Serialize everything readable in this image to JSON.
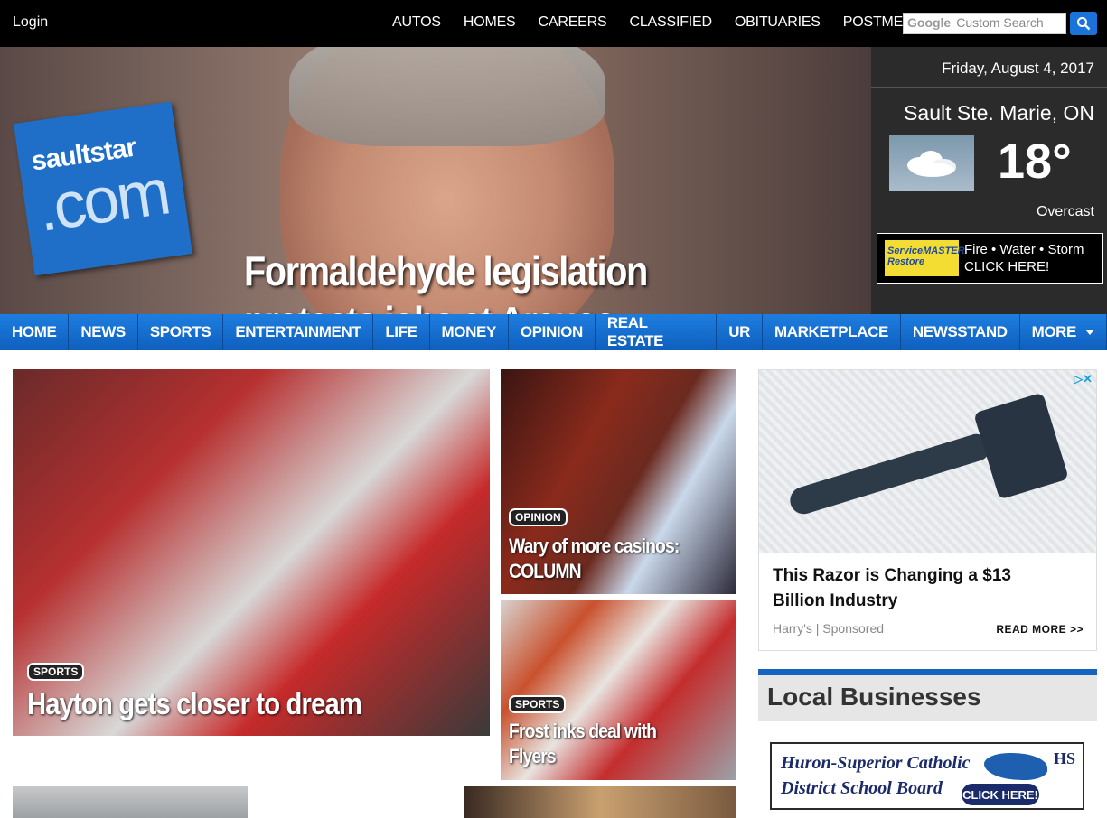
{
  "topbar": {
    "login": "Login",
    "nav": [
      "AUTOS",
      "HOMES",
      "CAREERS",
      "CLASSIFIED",
      "OBITUARIES",
      "POSTMEDIA"
    ],
    "search_brand": "Google",
    "search_placeholder": "Custom Search"
  },
  "logo": {
    "line1": "saultstar",
    "line2": ".com"
  },
  "hero": {
    "headline": "Formaldehyde legislation protects jobs at Arauco"
  },
  "weather": {
    "date": "Friday, August 4, 2017",
    "city": "Sault Ste. Marie, ON",
    "temp": "18°",
    "condition": "Overcast",
    "ad_brand": "ServiceMASTER Restore",
    "ad_line1": "Fire • Water • Storm",
    "ad_line2": "CLICK HERE!"
  },
  "mainnav": {
    "items": [
      "HOME",
      "NEWS",
      "SPORTS",
      "ENTERTAINMENT",
      "LIFE",
      "MONEY",
      "OPINION",
      "REAL ESTATE",
      "UR",
      "MARKETPLACE",
      "NEWSSTAND",
      "MORE"
    ]
  },
  "stories": [
    {
      "tag": "SPORTS",
      "title": "Hayton gets closer to dream"
    },
    {
      "tag": "OPINION",
      "title": "Wary of more casinos: COLUMN"
    },
    {
      "tag": "SPORTS",
      "title": "Frost inks deal with Flyers"
    }
  ],
  "ad": {
    "title": "This Razor is Changing a $13 Billion Industry",
    "sponsor": "Harry's | Sponsored",
    "readmore": "READ MORE >>"
  },
  "local": {
    "title": "Local Businesses",
    "ad_line1": "Huron-Superior Catholic",
    "ad_line2": "District School Board",
    "ad_click": "CLICK HERE!",
    "ad_mark": "HS"
  }
}
